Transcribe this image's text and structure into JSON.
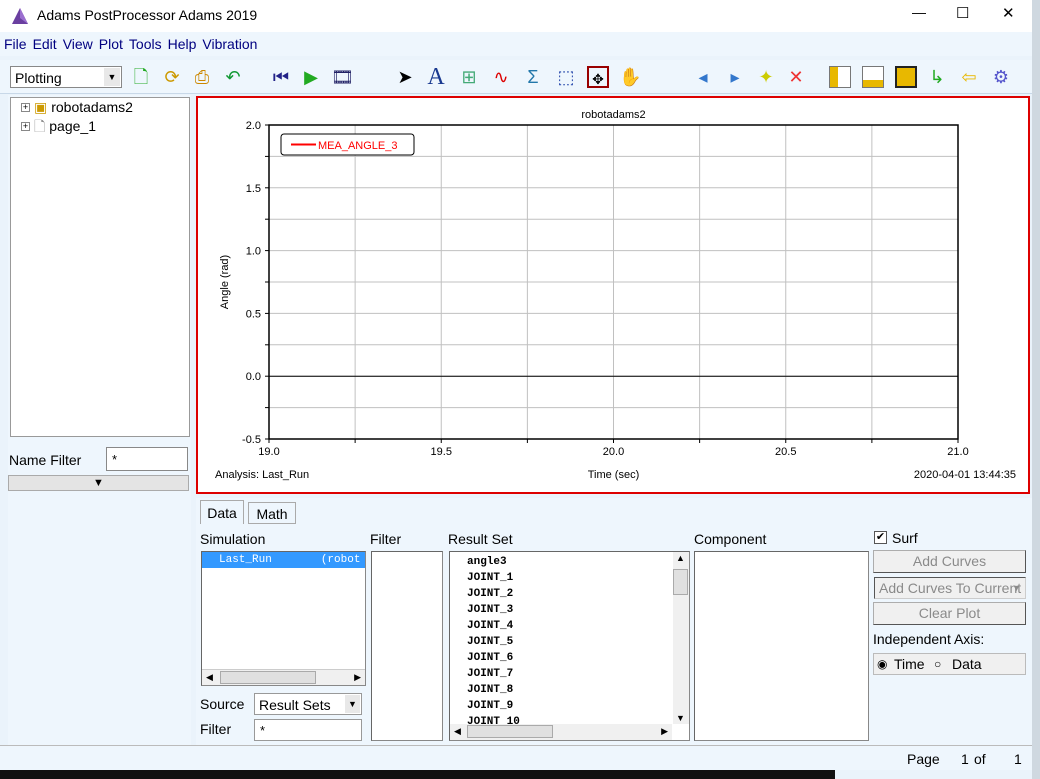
{
  "window": {
    "title": "Adams PostProcessor Adams 2019",
    "minimize": "—",
    "maximize": "☐",
    "close": "✕"
  },
  "menu": [
    "File",
    "Edit",
    "View",
    "Plot",
    "Tools",
    "Help",
    "Vibration"
  ],
  "toolbar": {
    "mode_select": "Plotting",
    "icons": [
      "new-page-icon",
      "refresh-icon",
      "print-icon",
      "undo-icon",
      "first-frame-icon",
      "play-icon",
      "animation-film-icon",
      "select-arrow-icon",
      "text-icon",
      "axis-icon",
      "curve-edit-icon",
      "sigma-statistics-icon",
      "zoom-box-icon",
      "fit-icon",
      "pan-hand-icon",
      "previous-page-icon",
      "next-page-icon",
      "new-page-icon",
      "delete-page-icon",
      "layout-1-icon",
      "layout-2-icon",
      "layout-3-icon",
      "return-icon",
      "exit-icon",
      "settings-gear-icon"
    ]
  },
  "tree": {
    "items": [
      {
        "label": "robotadams2",
        "expand": "+"
      },
      {
        "label": "page_1",
        "expand": "+"
      }
    ]
  },
  "name_filter": {
    "label": "Name Filter",
    "value": "*"
  },
  "plot": {
    "title": "robotadams2",
    "analysis_label": "Analysis:  Last_Run",
    "timestamp": "2020-04-01 13:44:35",
    "legend_placement": "top-left",
    "border_color": "#dd0000"
  },
  "chart_data": {
    "type": "line",
    "title": "robotadams2",
    "xlabel": "Time (sec)",
    "ylabel": "Angle (rad)",
    "xlim": [
      19.0,
      21.0
    ],
    "ylim": [
      -0.5,
      2.0
    ],
    "xticks": [
      "19.0",
      "19.5",
      "20.0",
      "20.5",
      "21.0"
    ],
    "yticks": [
      "2.0",
      "1.5",
      "1.0",
      "0.5",
      "0.0",
      "-0.5"
    ],
    "grid": true,
    "series": [
      {
        "name": "MEA_ANGLE_3",
        "color": "#ff0000",
        "x": [],
        "y": []
      }
    ]
  },
  "tabs": [
    {
      "label": "Data",
      "active": true
    },
    {
      "label": "Math",
      "active": false
    }
  ],
  "data_tab": {
    "simulation_label": "Simulation",
    "simulation_items": [
      {
        "name": "Last_Run",
        "model": "(robot"
      }
    ],
    "filter_label": "Filter",
    "result_set_label": "Result Set",
    "result_sets": [
      "angle3",
      "JOINT_1",
      "JOINT_2",
      "JOINT_3",
      "JOINT_4",
      "JOINT_5",
      "JOINT_6",
      "JOINT_7",
      "JOINT_8",
      "JOINT_9",
      "JOINT_10"
    ],
    "component_label": "Component",
    "source_label": "Source",
    "source_value": "Result Sets",
    "sim_filter_label": "Filter",
    "sim_filter_value": "*",
    "surf_label": "Surf",
    "surf_checked": true,
    "add_curves": "Add Curves",
    "add_mode": "Add Curves To Current",
    "clear_plot": "Clear Plot",
    "independent_axis_label": "Independent Axis:",
    "axis_options": [
      "Time",
      "Data"
    ],
    "axis_selected": "Time"
  },
  "status": {
    "page_label": "Page",
    "page": "1",
    "of": "of",
    "total": "1"
  }
}
